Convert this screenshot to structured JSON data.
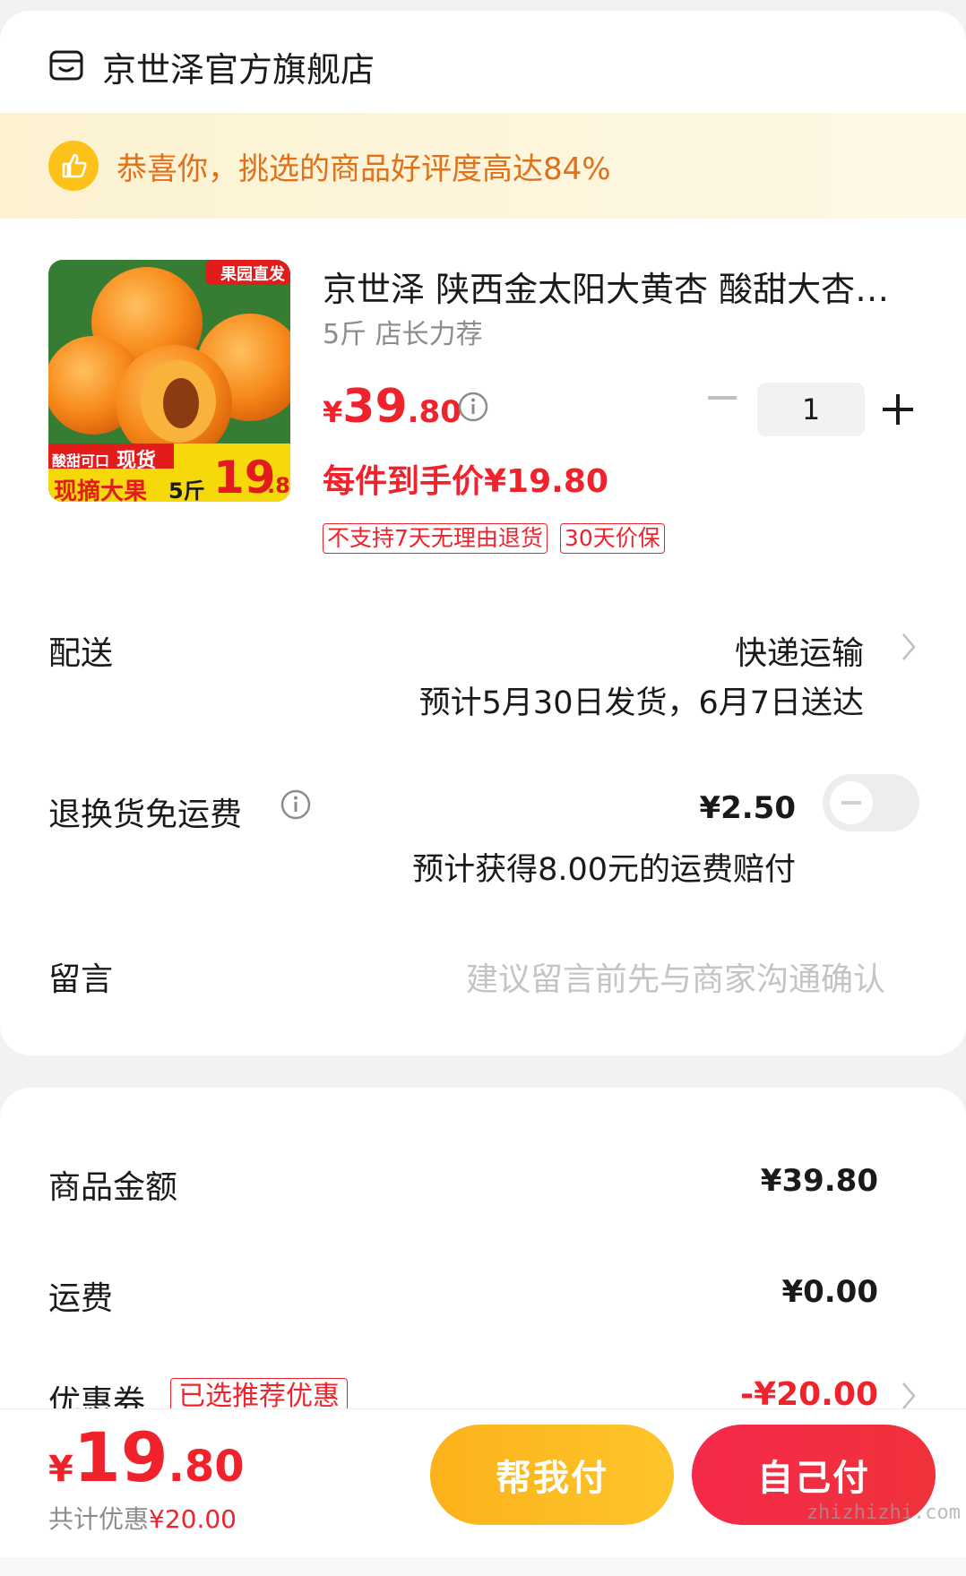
{
  "store": {
    "name": "京世泽官方旗舰店",
    "icon": "store-icon"
  },
  "banner": {
    "text": "恭喜你，挑选的商品好评度高达84%",
    "icon": "thumbs-up-icon"
  },
  "product": {
    "title": "京世泽 陕西金太阳大黄杏 酸甜大杏子 新鲜水果",
    "spec": "5斤 店长力荐",
    "price_yen": "¥",
    "price_int": "39",
    "price_dec": ".80",
    "deal_price": "每件到手价¥19.80",
    "quantity": "1",
    "tags": [
      "不支持7天无理由退货",
      "30天价保"
    ],
    "image": {
      "badge": "果园直发",
      "line1": "酸甜可口",
      "line1b": "现货",
      "line2": "现摘大果",
      "weight": "5斤",
      "price": "19",
      "price_dec": ".8"
    }
  },
  "delivery": {
    "label": "配送",
    "value": "快递运输",
    "estimate": "预计5月30日发货，6月7日送达"
  },
  "return_freight": {
    "label": "退换货免运费",
    "price": "¥2.50",
    "estimate": "预计获得8.00元的运费赔付",
    "enabled": false
  },
  "message": {
    "label": "留言",
    "placeholder": "建议留言前先与商家沟通确认"
  },
  "summary": {
    "goods_label": "商品金额",
    "goods_value": "¥39.80",
    "shipping_label": "运费",
    "shipping_value": "¥0.00",
    "coupon_label": "优惠券",
    "coupon_tag": "已选推荐优惠",
    "coupon_value": "-¥20.00"
  },
  "bottom": {
    "yen": "¥",
    "int": "19",
    "dec": ".80",
    "discount_label": "共计优惠",
    "discount_value": "¥20.00",
    "help_pay": "帮我付",
    "self_pay": "自己付"
  },
  "watermark": "zhizhizhi.com",
  "colors": {
    "accent_red": "#f0232d",
    "banner_orange": "#e0701a",
    "help_btn": "#fdc52a"
  }
}
